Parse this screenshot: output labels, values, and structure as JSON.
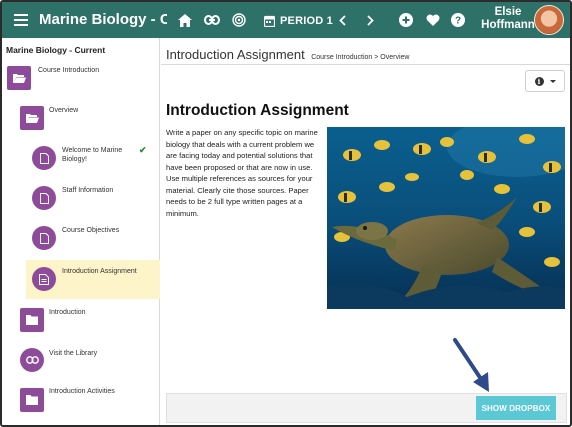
{
  "topbar": {
    "course_title": "Marine Biology - Curr...",
    "period_label": "PERIOD 1",
    "user_first": "Elsie",
    "user_last": "Hoffmann",
    "icons": [
      "menu-icon",
      "home-icon",
      "link-icon",
      "fingerprint-icon",
      "calendar-icon",
      "chevron-left-icon",
      "chevron-right-icon",
      "add-circle-icon",
      "heart-icon",
      "help-icon"
    ]
  },
  "sidebar": {
    "title": "Marine Biology - Current",
    "items": [
      {
        "label": "Course Introduction",
        "icon": "folder-open-icon"
      },
      {
        "label": "Overview",
        "icon": "folder-open-icon"
      },
      {
        "label": "Welcome to Marine Biology!",
        "icon": "page-icon",
        "completed": true
      },
      {
        "label": "Staff Information",
        "icon": "page-icon"
      },
      {
        "label": "Course Objectives",
        "icon": "page-icon"
      },
      {
        "label": "Introduction Assignment",
        "icon": "assignment-icon",
        "active": true
      },
      {
        "label": "Introduction",
        "icon": "folder-icon"
      },
      {
        "label": "Visit the Library",
        "icon": "link-icon"
      },
      {
        "label": "Introduction Activities",
        "icon": "folder-icon"
      }
    ]
  },
  "main": {
    "page_title": "Introduction Assignment",
    "breadcrumb": "Course Introduction > Overview",
    "content_title": "Introduction Assignment",
    "content_body": "Write a paper on any specific topic on marine biology that deals with a current problem we are facing today and potential solutions that have been proposed or that are now in use. Use multiple references as sources for your material. Clearly cite those sources. Paper needs to be 2 full type written pages at a minimum.",
    "dropbox_button": "SHOW DROPBOX"
  },
  "colors": {
    "topbar": "#2e7168",
    "sidebar_icon": "#8d4b99",
    "active_item": "#fdf5c9",
    "dropbox_button": "#5bc8d6",
    "arrow": "#2f4a8a"
  }
}
